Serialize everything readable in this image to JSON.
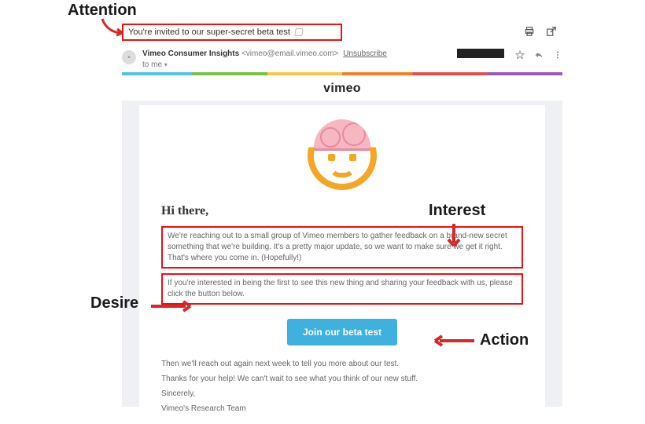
{
  "annotations": {
    "attention": "Attention",
    "interest": "Interest",
    "desire": "Desire",
    "action": "Action"
  },
  "subject": "You're invited to our super-secret beta test",
  "sender": {
    "name": "Vimeo Consumer Insights",
    "address": "<vimeo@email.vimeo.com>",
    "unsubscribe": "Unsubscribe",
    "to_line": "to me"
  },
  "brand": "vimeo",
  "greeting": "Hi there,",
  "paragraph_interest": "We're reaching out to a small group of Vimeo members to gather feedback on a brand-new secret something that we're building. It's a pretty major update, so we want to make sure we get it right. That's where you come in. (Hopefully!)",
  "paragraph_desire": "If you're interested in being the first to see this new thing and sharing your feedback with us, please click the button below.",
  "cta_label": "Join our beta test",
  "after": {
    "line1": "Then we'll reach out again next week to tell you more about our test.",
    "line2": "Thanks for your help! We can't wait to see what you think of our new stuff.",
    "signoff": "Sincerely,",
    "signature": "Vimeo's Research Team"
  }
}
